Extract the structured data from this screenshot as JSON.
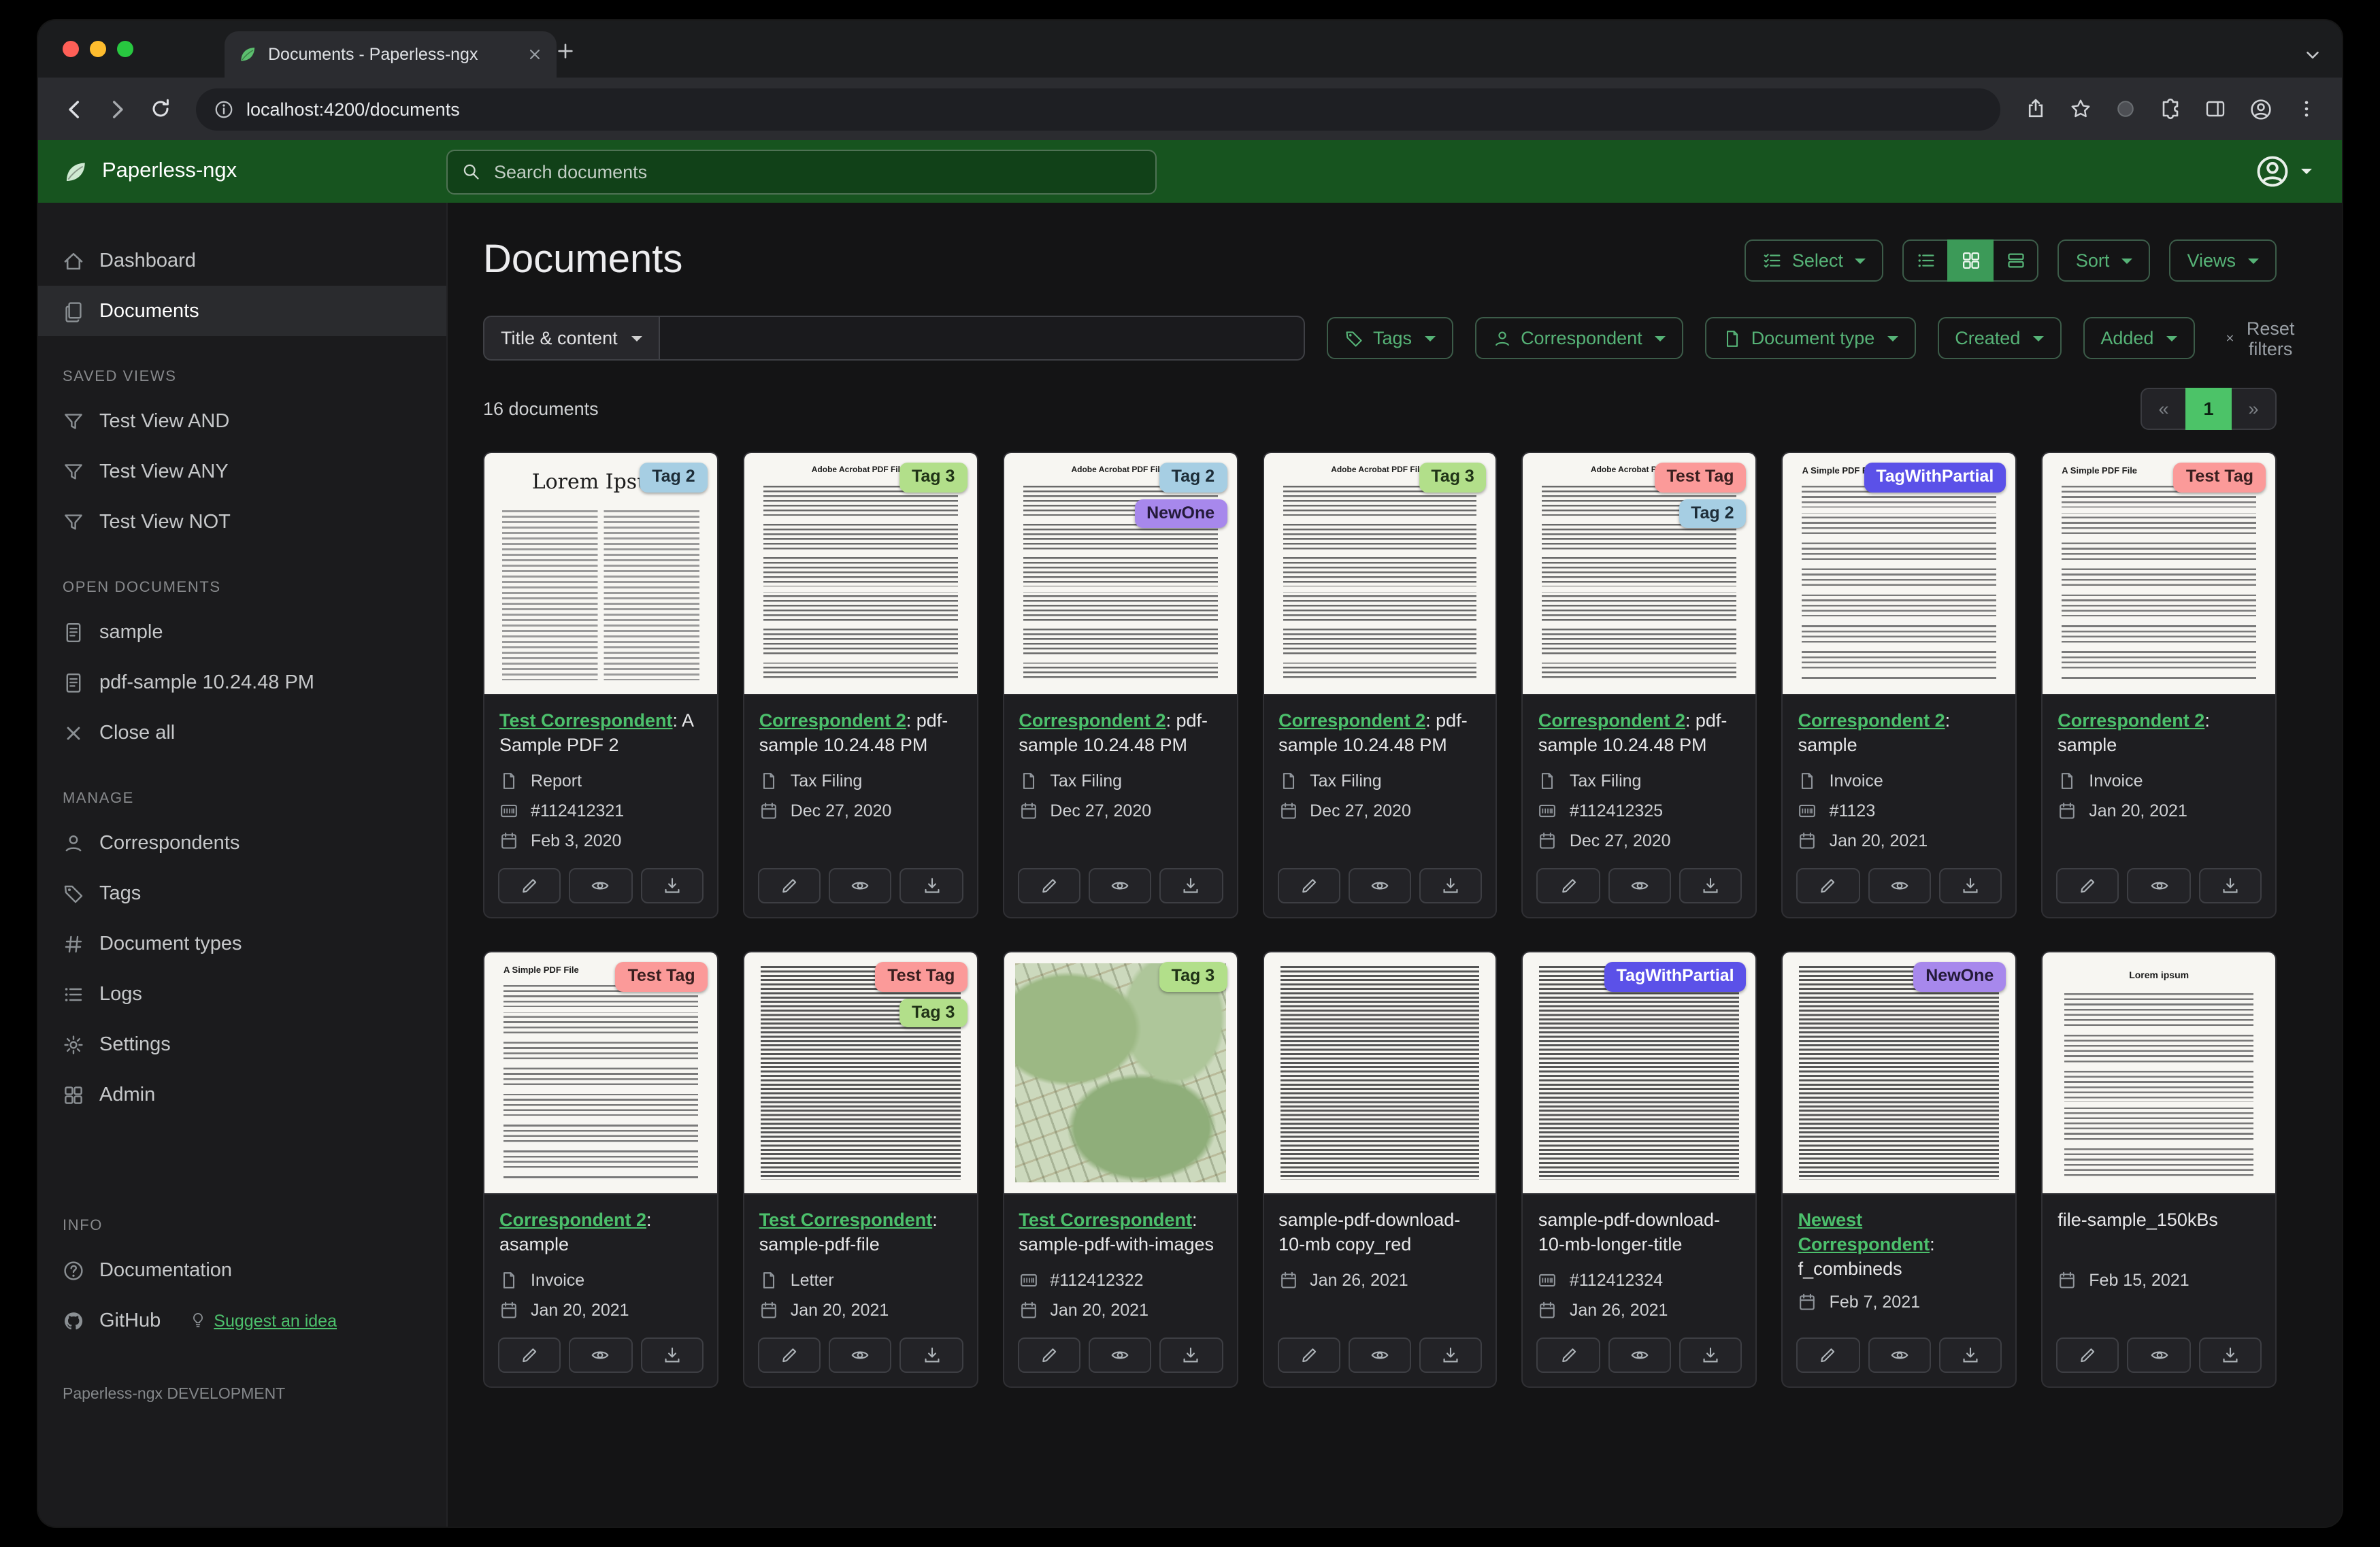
{
  "browser": {
    "tab_title": "Documents - Paperless-ngx",
    "url": "localhost:4200/documents"
  },
  "app": {
    "brand": "Paperless-ngx",
    "search_placeholder": "Search documents"
  },
  "sidebar": {
    "dashboard": "Dashboard",
    "documents": "Documents",
    "saved_views_title": "SAVED VIEWS",
    "saved_views": [
      "Test View AND",
      "Test View ANY",
      "Test View NOT"
    ],
    "open_documents_title": "OPEN DOCUMENTS",
    "open_documents": [
      "sample",
      "pdf-sample 10.24.48 PM"
    ],
    "close_all": "Close all",
    "manage_title": "MANAGE",
    "manage": [
      "Correspondents",
      "Tags",
      "Document types",
      "Logs",
      "Settings",
      "Admin"
    ],
    "info_title": "INFO",
    "documentation": "Documentation",
    "github": "GitHub",
    "suggest": "Suggest an idea",
    "footer": "Paperless-ngx DEVELOPMENT"
  },
  "page": {
    "title": "Documents",
    "select": "Select",
    "sort": "Sort",
    "views": "Views"
  },
  "filters": {
    "field": "Title & content",
    "field_value": "",
    "tags": "Tags",
    "correspondent": "Correspondent",
    "document_type": "Document type",
    "created": "Created",
    "added": "Added",
    "reset": "Reset filters"
  },
  "results": {
    "count": "16 documents",
    "page_prev": "«",
    "page_current": "1",
    "page_next": "»"
  },
  "colors": {
    "header_green": "#17541f",
    "accent_green": "#56b377",
    "link_green": "#4cc06c",
    "active_view_green": "#3c9a58",
    "active_page_green": "#4cc368",
    "tag_blue": "#a6cee3",
    "tag_light_green": "#b2df8a",
    "tag_salmon": "#fb9a99",
    "tag_purple": "#a788ec",
    "tag_indigo": "#5b51e8"
  },
  "icon_names": [
    "window-close",
    "window-minimize",
    "window-zoom",
    "paperless-favicon",
    "tab-close",
    "new-tab-plus",
    "tab-search-chevron",
    "back-arrow",
    "forward-arrow",
    "reload",
    "page-info",
    "share",
    "bookmark-star",
    "extension-action",
    "extensions-puzzle",
    "side-panel",
    "profile",
    "menu-kebab",
    "paperless-logo-leaf",
    "search-magnifier",
    "user-avatar",
    "caret-down",
    "house",
    "documents-files",
    "funnel",
    "file-text",
    "close-x",
    "person",
    "tag",
    "hash",
    "list-lines",
    "gear",
    "admin-grid",
    "question-circle",
    "github-mark",
    "lightbulb",
    "list-check",
    "list-view",
    "grid-view",
    "detail-view",
    "document-file",
    "calendar",
    "asn-barcode",
    "edit-pencil",
    "preview-eye",
    "download"
  ],
  "cards": [
    {
      "tags": [
        {
          "label": "Tag 2",
          "bg": "#a6cee3",
          "fg": "#1d2d38"
        }
      ],
      "thumb": {
        "kind": "lorem",
        "title": "Lorem Ipsum"
      },
      "title_link": "Test Correspondent",
      "title_rest": ": A Sample PDF 2",
      "doc_type": "Report",
      "asn": "#112412321",
      "date": "Feb 3, 2020"
    },
    {
      "tags": [
        {
          "label": "Tag 3",
          "bg": "#b2df8a",
          "fg": "#203317"
        }
      ],
      "thumb": {
        "kind": "acrobat",
        "title": "Adobe Acrobat PDF Files"
      },
      "title_link": "Correspondent 2",
      "title_rest": ": pdf-sample 10.24.48 PM",
      "doc_type": "Tax Filing",
      "date": "Dec 27, 2020"
    },
    {
      "tags": [
        {
          "label": "Tag 2",
          "bg": "#a6cee3",
          "fg": "#1d2d38"
        },
        {
          "label": "NewOne",
          "bg": "#a788ec",
          "fg": "#241a3a"
        }
      ],
      "thumb": {
        "kind": "acrobat",
        "title": "Adobe Acrobat PDF Files"
      },
      "title_link": "Correspondent 2",
      "title_rest": ": pdf-sample 10.24.48 PM",
      "doc_type": "Tax Filing",
      "date": "Dec 27, 2020"
    },
    {
      "tags": [
        {
          "label": "Tag 3",
          "bg": "#b2df8a",
          "fg": "#203317"
        }
      ],
      "thumb": {
        "kind": "acrobat",
        "title": "Adobe Acrobat PDF Files"
      },
      "title_link": "Correspondent 2",
      "title_rest": ": pdf-sample 10.24.48 PM",
      "doc_type": "Tax Filing",
      "date": "Dec 27, 2020"
    },
    {
      "tags": [
        {
          "label": "Test Tag",
          "bg": "#fb9a99",
          "fg": "#3a1f1f"
        },
        {
          "label": "Tag 2",
          "bg": "#a6cee3",
          "fg": "#1d2d38"
        }
      ],
      "thumb": {
        "kind": "acrobat",
        "title": "Adobe Acrobat PDF Files"
      },
      "title_link": "Correspondent 2",
      "title_rest": ": pdf-sample 10.24.48 PM",
      "doc_type": "Tax Filing",
      "asn": "#112412325",
      "date": "Dec 27, 2020"
    },
    {
      "tags": [
        {
          "label": "TagWithPartial",
          "bg": "#5b51e8",
          "fg": "#ffffff"
        }
      ],
      "thumb": {
        "kind": "simple",
        "title": "A Simple PDF File"
      },
      "title_link": "Correspondent 2",
      "title_rest": ": sample",
      "doc_type": "Invoice",
      "asn": "#1123",
      "date": "Jan 20, 2021"
    },
    {
      "tags": [
        {
          "label": "Test Tag",
          "bg": "#fb9a99",
          "fg": "#3a1f1f"
        }
      ],
      "thumb": {
        "kind": "simple",
        "title": "A Simple PDF File"
      },
      "title_link": "Correspondent 2",
      "title_rest": ": sample",
      "doc_type": "Invoice",
      "date": "Jan 20, 2021"
    },
    {
      "tags": [
        {
          "label": "Test Tag",
          "bg": "#fb9a99",
          "fg": "#3a1f1f"
        }
      ],
      "thumb": {
        "kind": "simple",
        "title": "A Simple PDF File"
      },
      "title_link": "Correspondent 2",
      "title_rest": ": asample",
      "doc_type": "Invoice",
      "date": "Jan 20, 2021"
    },
    {
      "tags": [
        {
          "label": "Test Tag",
          "bg": "#fb9a99",
          "fg": "#3a1f1f"
        },
        {
          "label": "Tag 3",
          "bg": "#b2df8a",
          "fg": "#203317"
        }
      ],
      "thumb": {
        "kind": "dense"
      },
      "title_link": "Test Correspondent",
      "title_rest": ": sample-pdf-file",
      "doc_type": "Letter",
      "date": "Jan 20, 2021"
    },
    {
      "tags": [
        {
          "label": "Tag 3",
          "bg": "#b2df8a",
          "fg": "#203317"
        }
      ],
      "thumb": {
        "kind": "map"
      },
      "title_link": "Test Correspondent",
      "title_rest": ": sample-pdf-with-images",
      "asn": "#112412322",
      "date": "Jan 20, 2021"
    },
    {
      "tags": [],
      "thumb": {
        "kind": "dense"
      },
      "title_rest": "sample-pdf-download-10-mb copy_red",
      "date": "Jan 26, 2021"
    },
    {
      "tags": [
        {
          "label": "TagWithPartial",
          "bg": "#5b51e8",
          "fg": "#ffffff"
        }
      ],
      "thumb": {
        "kind": "dense"
      },
      "title_rest": "sample-pdf-download-10-mb-longer-title",
      "asn": "#112412324",
      "date": "Jan 26, 2021"
    },
    {
      "tags": [
        {
          "label": "NewOne",
          "bg": "#a788ec",
          "fg": "#241a3a"
        }
      ],
      "thumb": {
        "kind": "dense"
      },
      "title_link": "Newest Correspondent",
      "title_rest": ": f_combineds",
      "date": "Feb 7, 2021"
    },
    {
      "tags": [],
      "thumb": {
        "kind": "lorem-center",
        "title": "Lorem ipsum"
      },
      "title_rest": "file-sample_150kBs",
      "date": "Feb 15, 2021"
    }
  ]
}
